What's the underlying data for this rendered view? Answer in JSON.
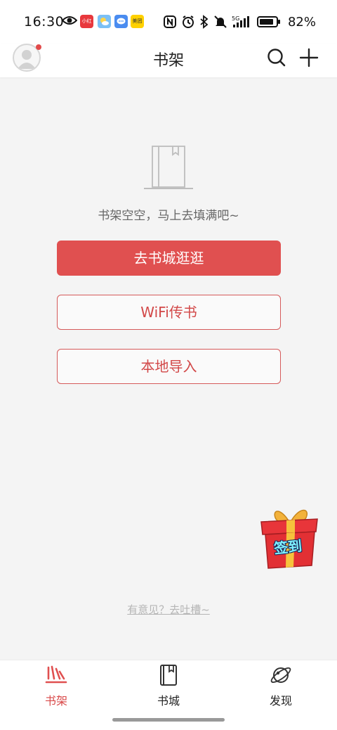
{
  "status_bar": {
    "time": "16:30",
    "apps": [
      "小红书",
      "天气",
      "消息",
      "美团"
    ],
    "network": "5G",
    "battery": "82%"
  },
  "header": {
    "title": "书架"
  },
  "empty_state": {
    "message": "书架空空，马上去填满吧~",
    "primary_button": "去书城逛逛",
    "wifi_button": "WiFi传书",
    "import_button": "本地导入"
  },
  "gift": {
    "label": "签到"
  },
  "feedback_link": "有意见？去吐槽~",
  "bottom_nav": {
    "items": [
      {
        "label": "书架",
        "active": true
      },
      {
        "label": "书城",
        "active": false
      },
      {
        "label": "发现",
        "active": false
      }
    ]
  },
  "colors": {
    "accent": "#e05050",
    "background": "#f4f4f4",
    "nav_active": "#d94a4a"
  }
}
